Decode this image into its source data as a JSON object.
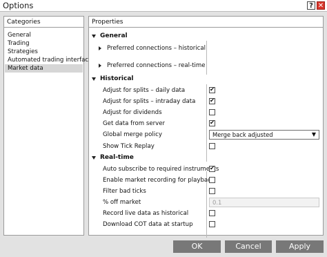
{
  "window": {
    "title": "Options",
    "help_glyph": "?",
    "close_glyph": "✕"
  },
  "categories": {
    "header": "Categories",
    "items": [
      {
        "label": "General",
        "selected": false
      },
      {
        "label": "Trading",
        "selected": false
      },
      {
        "label": "Strategies",
        "selected": false
      },
      {
        "label": "Automated trading interface",
        "selected": false
      },
      {
        "label": "Market data",
        "selected": true
      }
    ]
  },
  "properties": {
    "header": "Properties",
    "general": {
      "label": "General",
      "items": [
        {
          "label": "Preferred connections – historical"
        },
        {
          "label": "Preferred connections – real-time"
        }
      ]
    },
    "historical": {
      "label": "Historical",
      "adjust_splits_daily": {
        "label": "Adjust for splits – daily data",
        "checked": true
      },
      "adjust_splits_intraday": {
        "label": "Adjust for splits – intraday data",
        "checked": true
      },
      "adjust_dividends": {
        "label": "Adjust for dividends",
        "checked": false
      },
      "get_from_server": {
        "label": "Get data from server",
        "checked": true
      },
      "global_merge": {
        "label": "Global merge policy",
        "value": "Merge back adjusted"
      },
      "show_tick_replay": {
        "label": "Show Tick Replay",
        "checked": false
      }
    },
    "realtime": {
      "label": "Real-time",
      "auto_subscribe": {
        "label": "Auto subscribe to required instruments",
        "checked": true
      },
      "enable_recording": {
        "label": "Enable market recording for playback",
        "checked": false
      },
      "filter_bad_ticks": {
        "label": "Filter bad ticks",
        "checked": false
      },
      "pct_off_market": {
        "label": "% off market",
        "value": "0.1"
      },
      "record_live": {
        "label": "Record live data as historical",
        "checked": false
      },
      "download_cot": {
        "label": "Download COT data at startup",
        "checked": false
      }
    }
  },
  "buttons": {
    "ok": "OK",
    "cancel": "Cancel",
    "apply": "Apply"
  },
  "check_glyph": "✔",
  "chevron_glyph": "▼",
  "colors": {
    "button_bg": "#787878",
    "close_bg": "#d9372d",
    "selected_bg": "#d6d6d6"
  }
}
